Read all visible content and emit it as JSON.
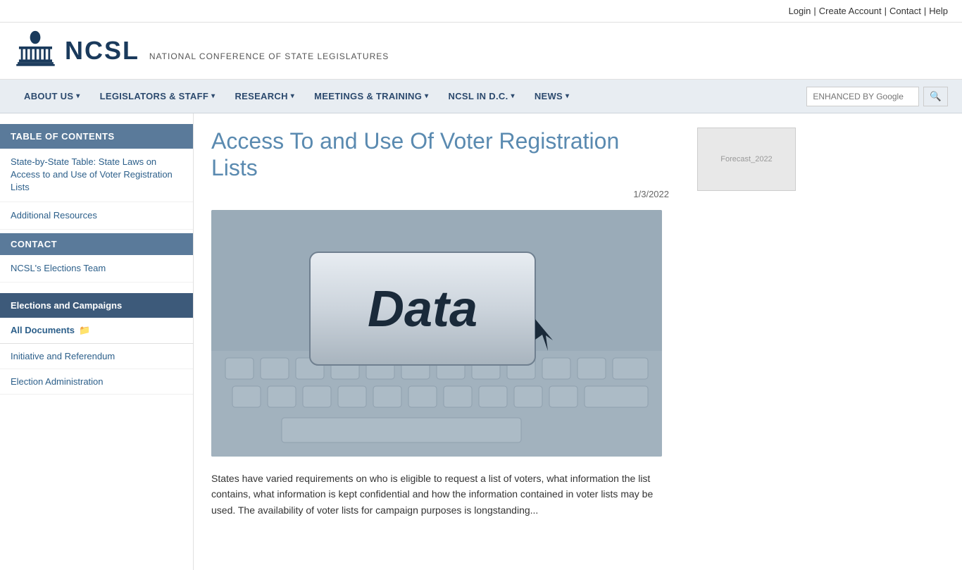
{
  "topbar": {
    "login": "Login",
    "separator1": "|",
    "create_account": "Create Account",
    "separator2": "|",
    "contact": "Contact",
    "separator3": "|",
    "help": "Help"
  },
  "header": {
    "logo_acronym": "NCSL",
    "logo_subtitle": "NATIONAL CONFERENCE OF STATE LEGISLATURES"
  },
  "nav": {
    "items": [
      {
        "label": "ABOUT US",
        "has_dropdown": true
      },
      {
        "label": "LEGISLATORS & STAFF",
        "has_dropdown": true
      },
      {
        "label": "RESEARCH",
        "has_dropdown": true
      },
      {
        "label": "MEETINGS & TRAINING",
        "has_dropdown": true
      },
      {
        "label": "NCSL IN D.C.",
        "has_dropdown": true
      },
      {
        "label": "NEWS",
        "has_dropdown": true
      }
    ],
    "search_placeholder": "ENHANCED BY Google",
    "search_button": "🔍"
  },
  "sidebar": {
    "toc_header": "TABLE OF CONTENTS",
    "toc_link1": "State-by-State Table: State Laws on Access to and Use of Voter Registration Lists",
    "toc_link2": "Additional Resources",
    "contact_header": "CONTACT",
    "contact_link": "NCSL's Elections Team",
    "category_header": "Elections and Campaigns",
    "all_docs_label": "All Documents",
    "sub_link1": "Initiative and Referendum",
    "sub_link2": "Election Administration"
  },
  "article": {
    "title": "Access To and Use Of Voter Registration Lists",
    "date": "1/3/2022",
    "image_alt": "Data keyboard key with cursor",
    "key_text": "Data",
    "body_text": "States have varied requirements on who is eligible to request a list of voters, what information the list contains, what information is kept confidential and how the information contained in voter lists may be used. The availability of voter lists for campaign purposes is longstanding..."
  },
  "right_sidebar": {
    "forecast_label": "Forecast_2022"
  }
}
